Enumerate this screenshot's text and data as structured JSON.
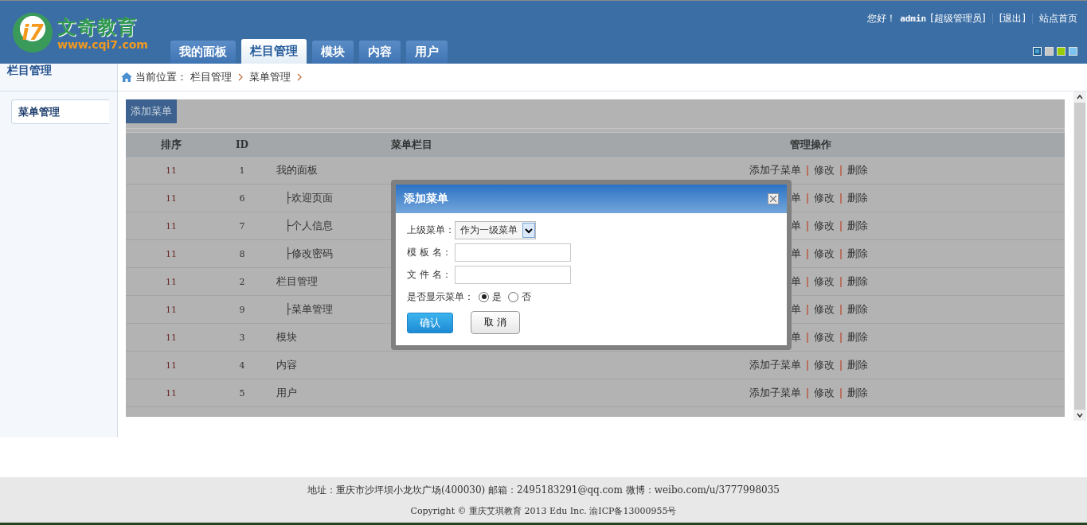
{
  "logo": {
    "badge": "i7",
    "name": "文奇教育",
    "url": "www.cqi7.com"
  },
  "nav_tabs": [
    {
      "label": "我的面板",
      "selected": false
    },
    {
      "label": "栏目管理",
      "selected": true
    },
    {
      "label": "模块",
      "selected": false
    },
    {
      "label": "内容",
      "selected": false
    },
    {
      "label": "用户",
      "selected": false
    }
  ],
  "user_bar": {
    "greeting": "您好！",
    "user": "admin",
    "role": "[超级管理员]",
    "logout": "[退出]",
    "home": "站点首页"
  },
  "theme_swatches": [
    {
      "color": "#4a9fd0",
      "selected": true
    },
    {
      "color": "#c8c8c8",
      "selected": false
    },
    {
      "color": "#99cc00",
      "selected": false
    },
    {
      "color": "#7cc4f0",
      "selected": false
    }
  ],
  "sidebar": {
    "title": "栏目管理",
    "items": [
      {
        "label": "菜单管理",
        "selected": true
      }
    ]
  },
  "breadcrumb": {
    "prefix": "当前位置：",
    "items": [
      "栏目管理",
      "菜单管理"
    ]
  },
  "toolbar": {
    "add_button": "添加菜单"
  },
  "table": {
    "columns": [
      "排序",
      "ID",
      "菜单栏目",
      "管理操作"
    ],
    "rows": [
      {
        "order": "11",
        "id": "1",
        "name": "我的面板",
        "child": false,
        "actions": [
          "添加子菜单",
          "修改",
          "删除"
        ]
      },
      {
        "order": "11",
        "id": "6",
        "name": "├欢迎页面",
        "child": true,
        "actions": [
          "单",
          "修改",
          "删除"
        ]
      },
      {
        "order": "11",
        "id": "7",
        "name": "├个人信息",
        "child": true,
        "actions": [
          "单",
          "修改",
          "删除"
        ]
      },
      {
        "order": "11",
        "id": "8",
        "name": "├修改密码",
        "child": true,
        "actions": [
          "单",
          "修改",
          "删除"
        ]
      },
      {
        "order": "11",
        "id": "2",
        "name": "栏目管理",
        "child": false,
        "actions": [
          "单",
          "修改",
          "删除"
        ]
      },
      {
        "order": "11",
        "id": "9",
        "name": "├菜单管理",
        "child": true,
        "actions": [
          "单",
          "修改",
          "删除"
        ]
      },
      {
        "order": "11",
        "id": "3",
        "name": "模块",
        "child": false,
        "actions": [
          "单",
          "修改",
          "删除"
        ]
      },
      {
        "order": "11",
        "id": "4",
        "name": "内容",
        "child": false,
        "actions": [
          "添加子菜单",
          "修改",
          "删除"
        ]
      },
      {
        "order": "11",
        "id": "5",
        "name": "用户",
        "child": false,
        "actions": [
          "添加子菜单",
          "修改",
          "删除"
        ]
      }
    ]
  },
  "dialog": {
    "title": "添加菜单",
    "parent_label": "上级菜单：",
    "parent_value": "作为一级菜单",
    "template_label": "模 板 名：",
    "file_label": "文 件 名：",
    "show_label": "是否显示菜单：",
    "show_options": [
      {
        "label": "是",
        "selected": true
      },
      {
        "label": "否",
        "selected": false
      }
    ],
    "confirm": "确认",
    "cancel": "取 消"
  },
  "footer": {
    "address": "地址：重庆市沙坪坝小龙坎广场(400030) 邮箱：2495183291@qq.com 微博：weibo.com/u/3777998035",
    "copyright": "Copyright © 重庆艾琪教育 2013 Edu Inc. 渝ICP备13000955号"
  }
}
